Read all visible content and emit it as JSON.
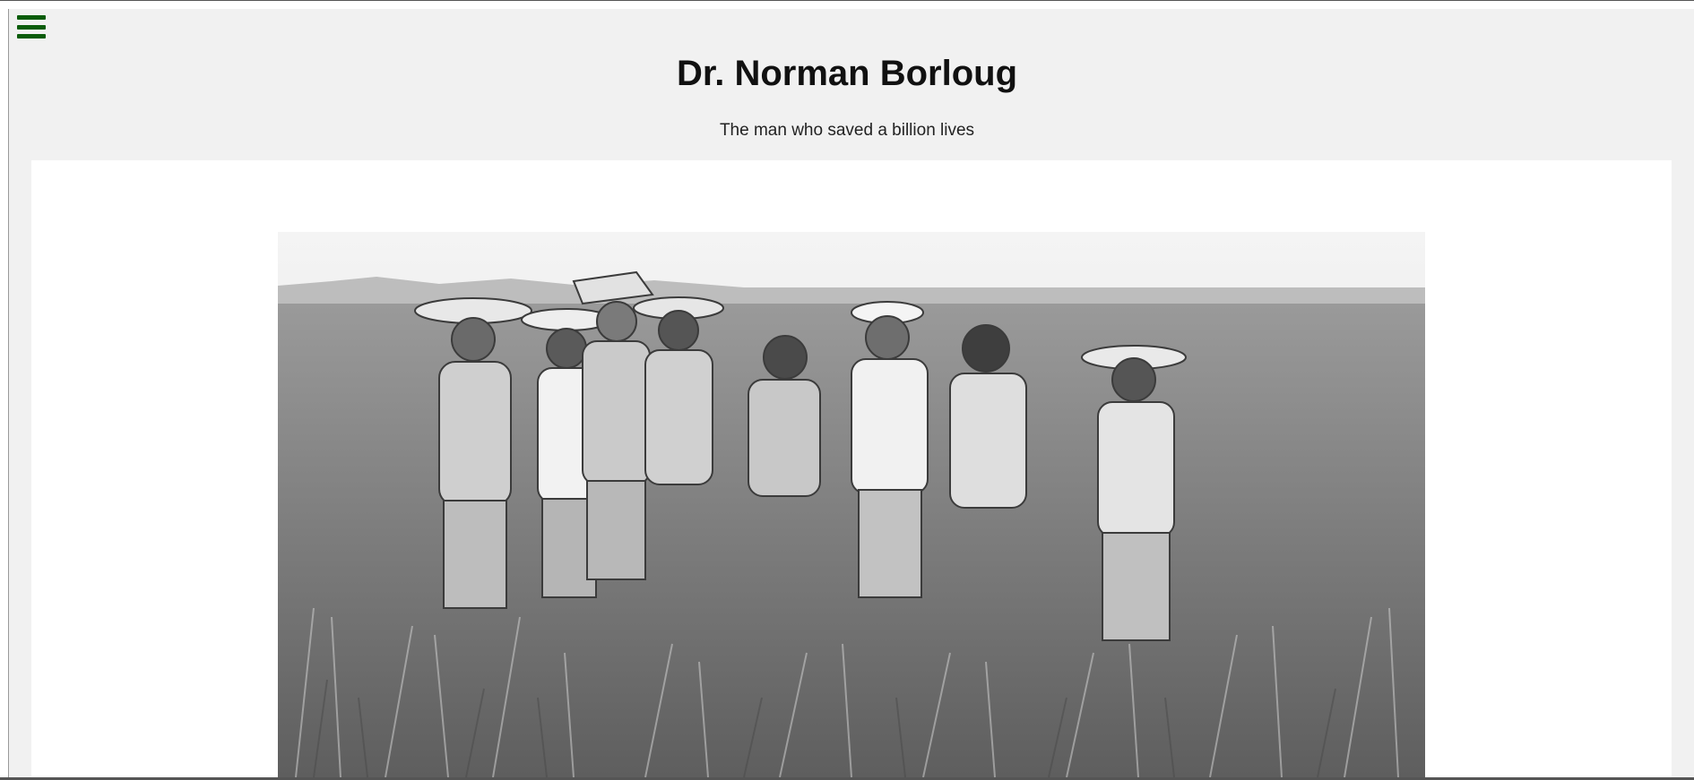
{
  "page": {
    "title": "Dr. Norman Borloug",
    "subtitle": "The man who saved a billion lives"
  },
  "nav": {
    "menu_icon": "hamburger-menu-icon",
    "accent_color": "#0a5c0a"
  },
  "hero_image": {
    "description_icon": "photo"
  }
}
